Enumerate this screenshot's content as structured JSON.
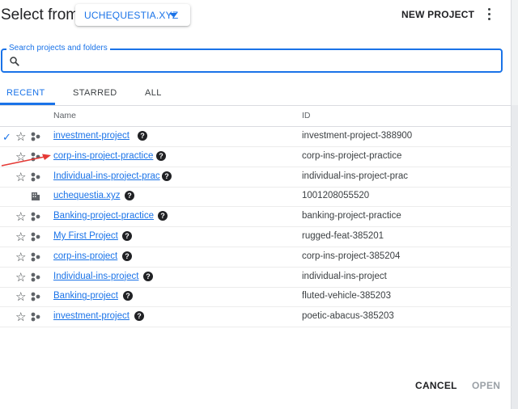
{
  "dialog": {
    "title": "Select from",
    "organization": "UCHEQUESTIA.XYZ",
    "new_project": "NEW PROJECT"
  },
  "search": {
    "label": "Search projects and folders",
    "value": ""
  },
  "tabs": [
    {
      "label": "RECENT",
      "active": true
    },
    {
      "label": "STARRED",
      "active": false
    },
    {
      "label": "ALL",
      "active": false
    }
  ],
  "table": {
    "columns": [
      "Name",
      "ID"
    ],
    "rows": [
      {
        "name": "investment-project",
        "id": "investment-project-388900",
        "selected": true,
        "type": "project"
      },
      {
        "name": "corp-ins-project-practice",
        "id": "corp-ins-project-practice",
        "selected": false,
        "type": "project"
      },
      {
        "name": "Individual-ins-project-prac",
        "id": "individual-ins-project-prac",
        "selected": false,
        "type": "project"
      },
      {
        "name": "uchequestia.xyz",
        "id": "1001208055520",
        "selected": false,
        "type": "organization"
      },
      {
        "name": "Banking-project-practice",
        "id": "banking-project-practice",
        "selected": false,
        "type": "project"
      },
      {
        "name": "My First Project",
        "id": "rugged-feat-385201",
        "selected": false,
        "type": "project"
      },
      {
        "name": "corp-ins-project",
        "id": "corp-ins-project-385204",
        "selected": false,
        "type": "project"
      },
      {
        "name": "Individual-ins-project",
        "id": "individual-ins-project",
        "selected": false,
        "type": "project"
      },
      {
        "name": "Banking-project",
        "id": "fluted-vehicle-385203",
        "selected": false,
        "type": "project"
      },
      {
        "name": "investment-project",
        "id": "poetic-abacus-385203",
        "selected": false,
        "type": "project"
      }
    ]
  },
  "footer": {
    "cancel": "CANCEL",
    "open": "OPEN"
  },
  "colors": {
    "accent": "#1a73e8",
    "annotation_arrow": "#e53935"
  }
}
